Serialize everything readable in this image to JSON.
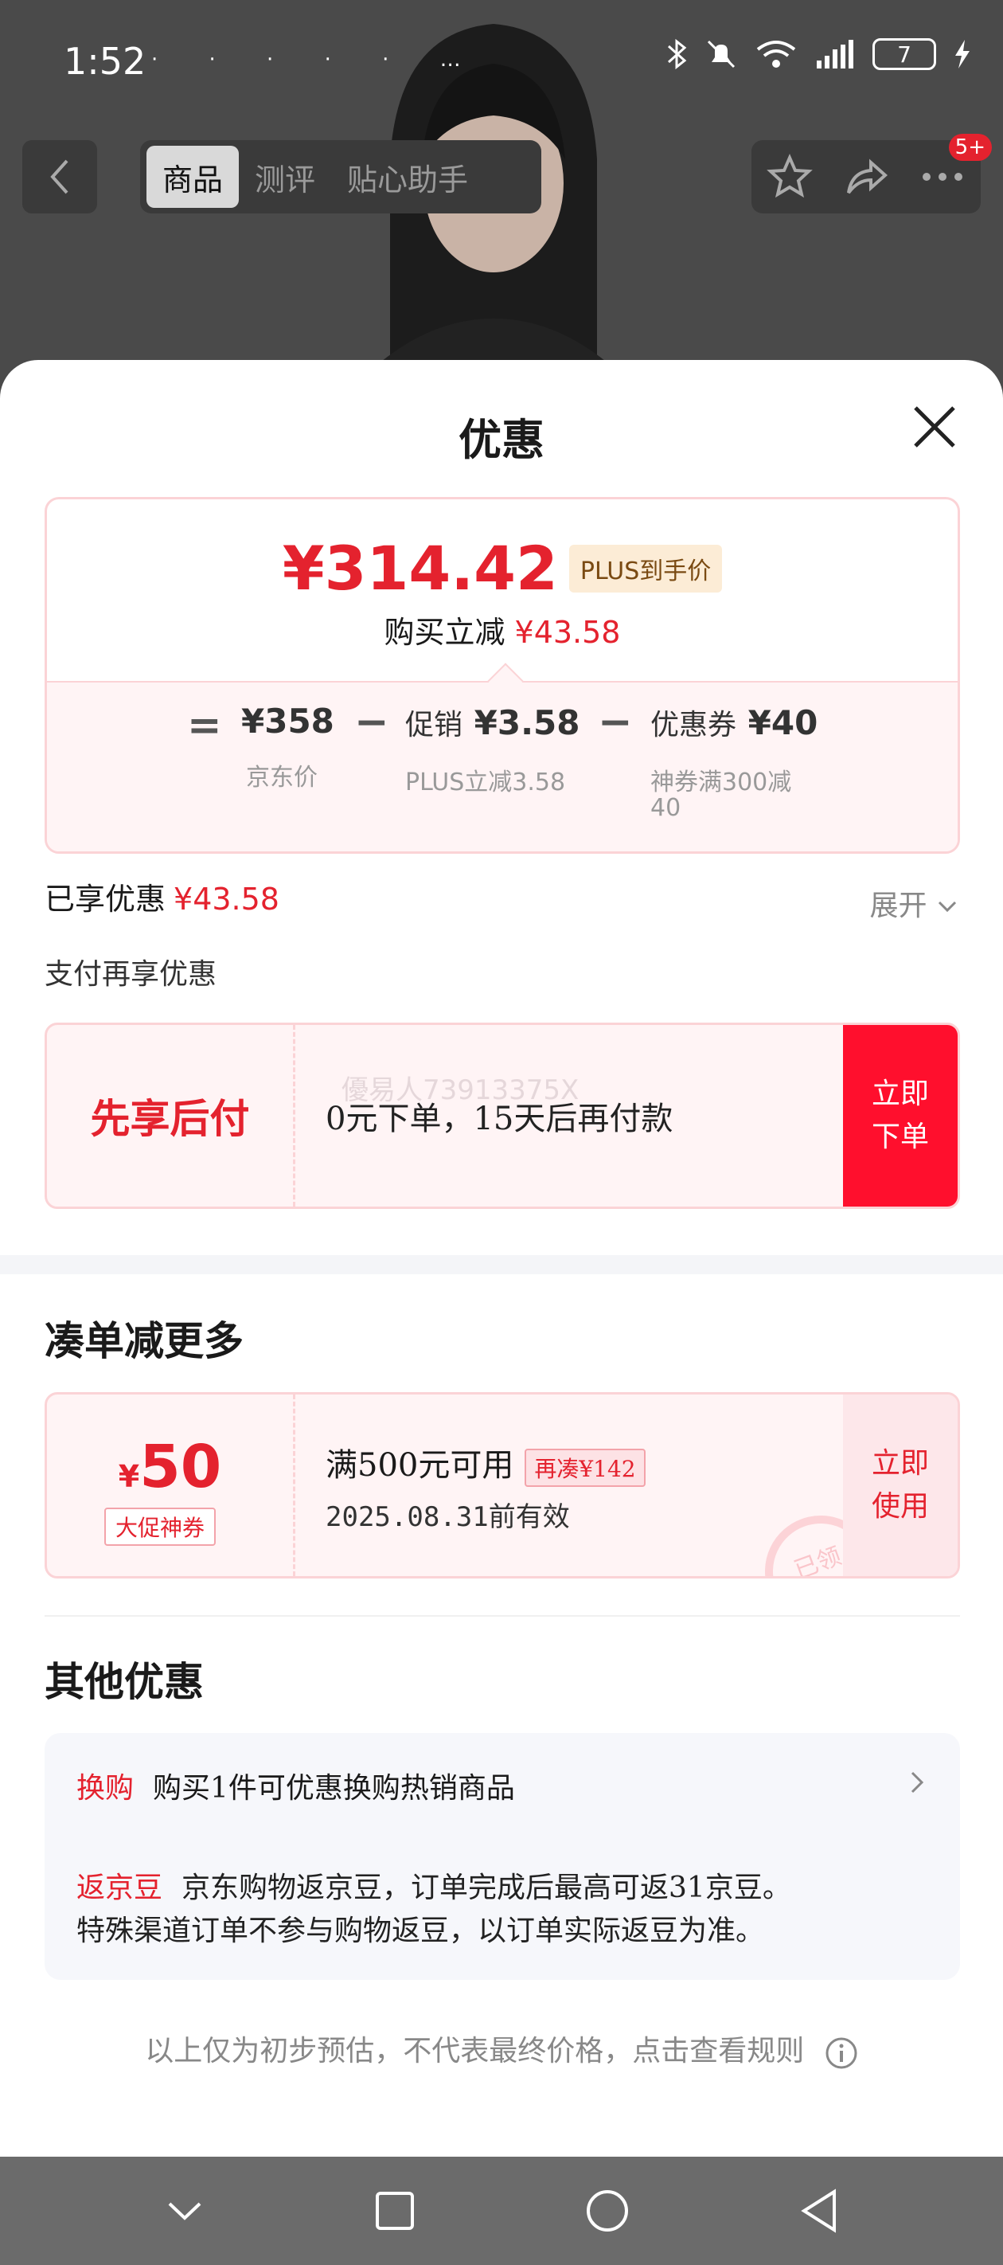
{
  "status_bar": {
    "time": "1:52",
    "more": "…",
    "battery": "7"
  },
  "nav": {
    "tabs": [
      "商品",
      "测评",
      "贴心助手"
    ],
    "active_tab": 0,
    "badge": "5+"
  },
  "sheet": {
    "title": "优惠",
    "price": {
      "final_price": "¥314.42",
      "plus_tag": "PLUS到手价",
      "discount_label": "购买立减",
      "discount_value": "¥43.58",
      "formula": {
        "eq": "=",
        "jd_price": "¥358",
        "jd_price_label": "京东价",
        "minus1": "−",
        "promo_prefix": "促销",
        "promo_value": "¥3.58",
        "promo_label": "PLUS立减3.58",
        "minus2": "−",
        "coupon_prefix": "优惠券",
        "coupon_value": "¥40",
        "coupon_label_line1": "神券满300减",
        "coupon_label_line2": "40"
      }
    },
    "enjoyed_label": "已享优惠",
    "enjoyed_value": "¥43.58",
    "expand_label": "展开",
    "pay_more_label": "支付再享优惠",
    "bnpl": {
      "title": "先享后付",
      "desc": "0元下单，15天后再付款",
      "watermark": "優易人73913375X",
      "button_line1": "立即",
      "button_line2": "下单"
    },
    "bundle_section": {
      "title": "凑单减更多",
      "coupon": {
        "currency": "¥",
        "amount": "50",
        "tag": "大促神券",
        "condition": "满500元可用",
        "more_tag": "再凑¥142",
        "valid_until": "2025.08.31前有效",
        "stamp": "已领",
        "button_line1": "立即",
        "button_line2": "使用"
      }
    },
    "other_section": {
      "title": "其他优惠",
      "exchange_key": "换购",
      "exchange_text": "购买1件可优惠换购热销商品",
      "beans_key": "返京豆",
      "beans_line1": "京东购物返京豆，订单完成后最高可返31京豆。",
      "beans_line2": "特殊渠道订单不参与购物返豆，以订单实际返豆为准。"
    },
    "footnote": "以上仅为初步预估，不代表最终价格，点击查看规则"
  },
  "colors": {
    "accent_red": "#e4222e",
    "button_red": "#ff0f2d",
    "card_pink": "#fff4f5",
    "card_border": "#fbd3d6"
  }
}
